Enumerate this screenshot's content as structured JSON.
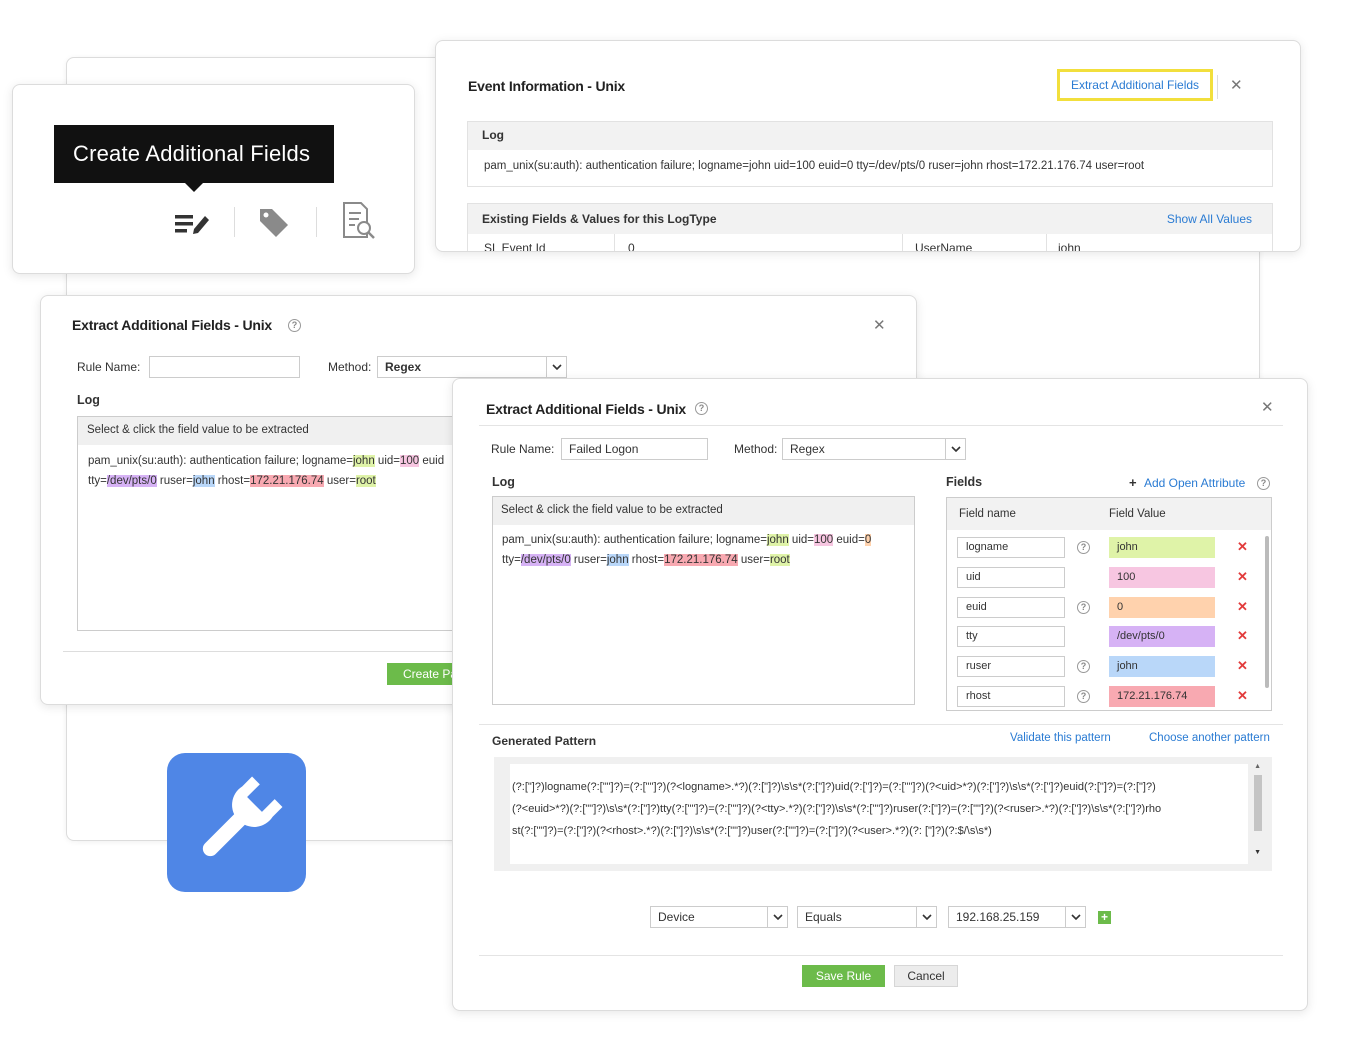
{
  "tooltip": {
    "text": "Create Additional Fields"
  },
  "event_info": {
    "title": "Event Information - Unix",
    "extract_link": "Extract Additional Fields",
    "log_label": "Log",
    "log_text": "pam_unix(su:auth): authentication failure; logname=john uid=100 euid=0 tty=/dev/pts/0 ruser=john rhost=172.21.176.74 user=root",
    "existing_label": "Existing Fields & Values for this LogType",
    "show_all": "Show All Values",
    "row": {
      "k1": "SL Event Id",
      "v1": "0",
      "k2": "UserName",
      "v2": "john"
    }
  },
  "extract_back": {
    "title": "Extract Additional Fields - Unix",
    "rule_name_label": "Rule Name:",
    "rule_name_value": "",
    "method_label": "Method:",
    "method_value": "Regex",
    "log_label": "Log",
    "log_hint": "Select & click the field value to be extracted",
    "line1": {
      "a": "pam_unix(su:auth): authentication failure; logname=",
      "b": "john",
      "c": " uid=",
      "d": "100",
      "e": " euid"
    },
    "line2": {
      "a": "tty=",
      "b": "/dev/pts/0",
      "c": " ruser=",
      "d": "john",
      "e": " rhost=",
      "f": "172.21.176.74",
      "g": " user=",
      "h": "root"
    },
    "create_button": "Create Pa"
  },
  "extract_front": {
    "title": "Extract Additional Fields - Unix",
    "rule_name_label": "Rule Name:",
    "rule_name_value": "Failed Logon",
    "method_label": "Method:",
    "method_value": "Regex",
    "log_label": "Log",
    "log_hint": "Select & click the field value to be extracted",
    "line1": {
      "a": "pam_unix(su:auth): authentication failure; logname=",
      "b": "john",
      "c": " uid=",
      "d": "100",
      "e": " euid=",
      "f": "0"
    },
    "line2": {
      "a": "tty=",
      "b": "/dev/pts/0",
      "c": " ruser=",
      "d": "john",
      "e": " rhost=",
      "f": "172.21.176.74",
      "g": " user=",
      "h": "root"
    },
    "fields_label": "Fields",
    "add_attr": "Add Open Attribute",
    "col_name": "Field name",
    "col_value": "Field Value",
    "fields": [
      {
        "name": "logname",
        "value": "john",
        "color": "#dff3a8",
        "help": true
      },
      {
        "name": "uid",
        "value": "100",
        "color": "#f7c6e1",
        "help": false
      },
      {
        "name": "euid",
        "value": "0",
        "color": "#ffd2ad",
        "help": true
      },
      {
        "name": "tty",
        "value": "/dev/pts/0",
        "color": "#d6b2f5",
        "help": false
      },
      {
        "name": "ruser",
        "value": "john",
        "color": "#b9d7f9",
        "help": true
      },
      {
        "name": "rhost",
        "value": "172.21.176.74",
        "color": "#f8a9b1",
        "help": true
      }
    ],
    "pattern_label": "Generated Pattern",
    "validate_link": "Validate this pattern",
    "choose_link": "Choose another pattern",
    "pattern_lines": [
      "(?:[\"]?)logname(?:[\"\"]?)=(?:[\"\"]?)(?<logname>.*?)(?:[\"]?)\\s\\s*(?:[\"]?)uid(?:[\"]?)=(?:[\"\"]?)(?<uid>*?)(?:[\"]?)\\s\\s*(?:[\"]?)euid(?:[\"]?)=(?:[\"]?)",
      "(?<euid>*?)(?:[\"\"]?)\\s\\s*(?:[\"]?)tty(?:[\"\"]?)=(?:[\"\"]?)(?<tty>.*?)(?:[\"]?)\\s\\s*(?:[\"\"]?)ruser(?:[\"]?)=(?:[\"\"]?)(?<ruser>.*?)(?:[\"]?)\\s\\s*(?:[\"]?)rho",
      "st(?:[\"\"]?)=(?:[\"]?)(?<rhost>.*?)(?:[\"]?)\\s\\s*(?:[\"\"]?)user(?:[\"\"]?)=(?:[\"]?)(?<user>.*?)(?: [\"]?)(?:$/\\s\\s*)"
    ],
    "criteria": {
      "field": "Device",
      "operator": "Equals",
      "value": "192.168.25.159"
    },
    "save_button": "Save Rule",
    "cancel_button": "Cancel"
  },
  "colors": {
    "green": "#6cbb4a",
    "link": "#2a7bd3",
    "wrench_tile": "#4f86e6",
    "highlight_border": "#f2df3c"
  },
  "icons": [
    "edit-list-icon",
    "tag-icon",
    "search-document-icon",
    "wrench-icon",
    "help-icon",
    "close-icon",
    "plus-icon",
    "chevron-down-icon"
  ]
}
